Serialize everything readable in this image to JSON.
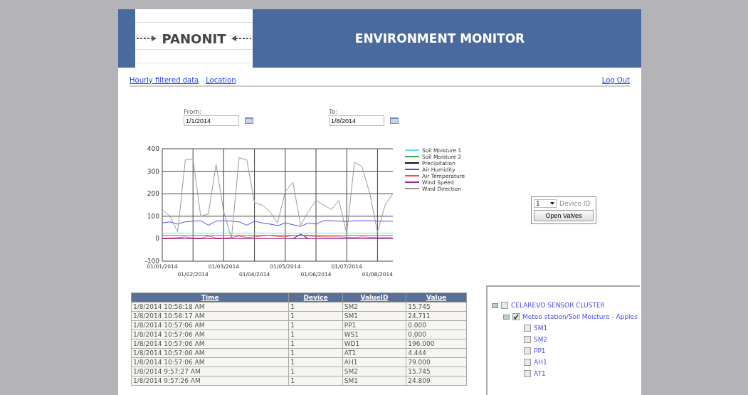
{
  "header": {
    "logo_text": "PANONIT",
    "title": "ENVIRONMENT MONITOR"
  },
  "nav": {
    "links": [
      "Hourly filtered data",
      "Location"
    ],
    "logout": "Log Out"
  },
  "date_range": {
    "from_label": "From:",
    "from_value": "1/1/2014",
    "to_label": "To:",
    "to_value": "1/8/2014"
  },
  "chart": {
    "chart_data": {
      "type": "line",
      "categories": [
        "01/01/2014",
        null,
        null,
        null,
        "01/02/2014",
        null,
        null,
        null,
        "01/03/2014",
        null,
        null,
        null,
        "01/04/2014",
        null,
        null,
        null,
        "01/05/2014",
        null,
        null,
        null,
        "01/06/2014",
        null,
        null,
        null,
        "01/07/2014",
        null,
        null,
        null,
        "01/08/2014",
        null,
        null
      ],
      "ylim": [
        -100,
        400
      ],
      "yticks": [
        -100,
        0,
        100,
        200,
        300,
        400
      ],
      "grid": true,
      "legend": true,
      "series": [
        {
          "name": "Soil Moisture 1",
          "color": "#66e0e0",
          "values": [
            25,
            25,
            25,
            25,
            25,
            25,
            25,
            25,
            25,
            25,
            25,
            25,
            25,
            25,
            25,
            25,
            25,
            25,
            25,
            25,
            25,
            25,
            25,
            25,
            25,
            25,
            25,
            25,
            25,
            25,
            25
          ]
        },
        {
          "name": "Soil Moisture 2",
          "color": "#3aa04a",
          "values": [
            15,
            15,
            15,
            15,
            15,
            15,
            15,
            15,
            15,
            15,
            15,
            15,
            15,
            15,
            15,
            15,
            15,
            15,
            15,
            15,
            15,
            15,
            15,
            15,
            15,
            15,
            15,
            15,
            15,
            15,
            15
          ]
        },
        {
          "name": "Precipitation",
          "color": "#111111",
          "values": [
            null,
            null,
            null,
            null,
            null,
            null,
            null,
            null,
            null,
            null,
            null,
            null,
            null,
            null,
            null,
            null,
            null,
            0,
            20,
            0,
            null,
            null,
            null,
            null,
            null,
            null,
            null,
            null,
            null,
            null,
            null
          ]
        },
        {
          "name": "Air Humidity",
          "color": "#4b4bff",
          "values": [
            70,
            75,
            65,
            75,
            78,
            80,
            60,
            78,
            80,
            78,
            75,
            60,
            78,
            70,
            65,
            58,
            70,
            62,
            55,
            70,
            65,
            80,
            80,
            78,
            76,
            80,
            80,
            80,
            78,
            78,
            78
          ]
        },
        {
          "name": "Air Temperature",
          "color": "#ff4a4a",
          "values": [
            2,
            3,
            5,
            8,
            3,
            2,
            12,
            3,
            2,
            5,
            12,
            5,
            8,
            12,
            15,
            10,
            8,
            15,
            15,
            12,
            10,
            8,
            8,
            8,
            6,
            5,
            8,
            6,
            5,
            5,
            4
          ]
        },
        {
          "name": "Wind Speed",
          "color": "#a020a0",
          "values": [
            0,
            0,
            0,
            0,
            0,
            0,
            0,
            0,
            0,
            0,
            0,
            0,
            0,
            0,
            0,
            0,
            0,
            0,
            0,
            0,
            0,
            0,
            0,
            0,
            0,
            0,
            0,
            0,
            0,
            0,
            0
          ]
        },
        {
          "name": "Wind Direction",
          "color": "#999999",
          "values": [
            130,
            100,
            30,
            350,
            355,
            100,
            110,
            330,
            120,
            0,
            360,
            350,
            160,
            150,
            120,
            70,
            210,
            250,
            60,
            120,
            170,
            150,
            130,
            170,
            20,
            340,
            320,
            200,
            30,
            150,
            200
          ]
        }
      ]
    }
  },
  "device": {
    "id_value": "1",
    "id_label": "Device ID",
    "button": "Open Valves"
  },
  "table": {
    "columns": [
      "Time",
      "Device",
      "ValueID",
      "Value"
    ],
    "rows": [
      [
        "1/8/2014 10:58:18 AM",
        "1",
        "SM2",
        "15.745"
      ],
      [
        "1/8/2014 10:58:17 AM",
        "1",
        "SM1",
        "24.711"
      ],
      [
        "1/8/2014 10:57:06 AM",
        "1",
        "PP1",
        "0.000"
      ],
      [
        "1/8/2014 10:57:06 AM",
        "1",
        "WS1",
        "0.000"
      ],
      [
        "1/8/2014 10:57:06 AM",
        "1",
        "WD1",
        "196.000"
      ],
      [
        "1/8/2014 10:57:06 AM",
        "1",
        "AT1",
        "4.444"
      ],
      [
        "1/8/2014 10:57:06 AM",
        "1",
        "AH1",
        "79.000"
      ],
      [
        "1/8/2014 9:57:27 AM",
        "1",
        "SM2",
        "15.745"
      ],
      [
        "1/8/2014 9:57:26 AM",
        "1",
        "SM1",
        "24.809"
      ]
    ]
  },
  "tree": {
    "items": [
      {
        "label": "CELAREVO SENSOR CLUSTER",
        "checked": false,
        "expanded": true,
        "children": [
          {
            "label": "Meteo station/Soil Moisture - Apples",
            "checked": true,
            "expanded": true,
            "children": [
              {
                "label": "SM1",
                "checked": false
              },
              {
                "label": "SM2",
                "checked": false
              },
              {
                "label": "PP1",
                "checked": false
              },
              {
                "label": "AH1",
                "checked": false
              },
              {
                "label": "AT1",
                "checked": false
              }
            ]
          }
        ]
      }
    ]
  }
}
